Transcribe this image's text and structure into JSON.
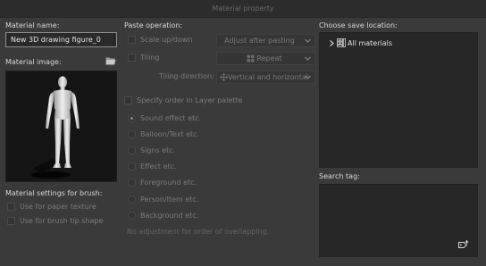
{
  "window": {
    "title": "Material property"
  },
  "material_name": {
    "label": "Material name:",
    "value": "New 3D drawing figure_0"
  },
  "material_image": {
    "label": "Material image:",
    "folder_icon": "folder-open-icon"
  },
  "brush_settings": {
    "label": "Material settings for brush:",
    "paper_texture": "Use for paper texture",
    "brush_tip": "Use for brush tip shape"
  },
  "paste": {
    "label": "Paste operation:",
    "scale_label": "Scale up/down",
    "scale_value": "Adjust after pasting",
    "tiling_label": "Tiling",
    "tiling_value": "Repeat",
    "tiling_direction_label": "Tiling direction:",
    "tiling_direction_value": "Vertical and horizontal",
    "specify_order": "Specify order in Layer palette",
    "layer_options": [
      "Sound effect etc.",
      "Balloon/Text etc.",
      "Signs etc.",
      "Effect etc.",
      "Foreground etc.",
      "Person/Item etc.",
      "Background etc."
    ],
    "selected_layer_option": "Sound effect etc.",
    "note": "No adjustment for order of overlapping."
  },
  "save_location": {
    "label": "Choose save location:",
    "item": "All materials"
  },
  "search_tag": {
    "label": "Search tag:",
    "icon": "add-tag-icon"
  }
}
